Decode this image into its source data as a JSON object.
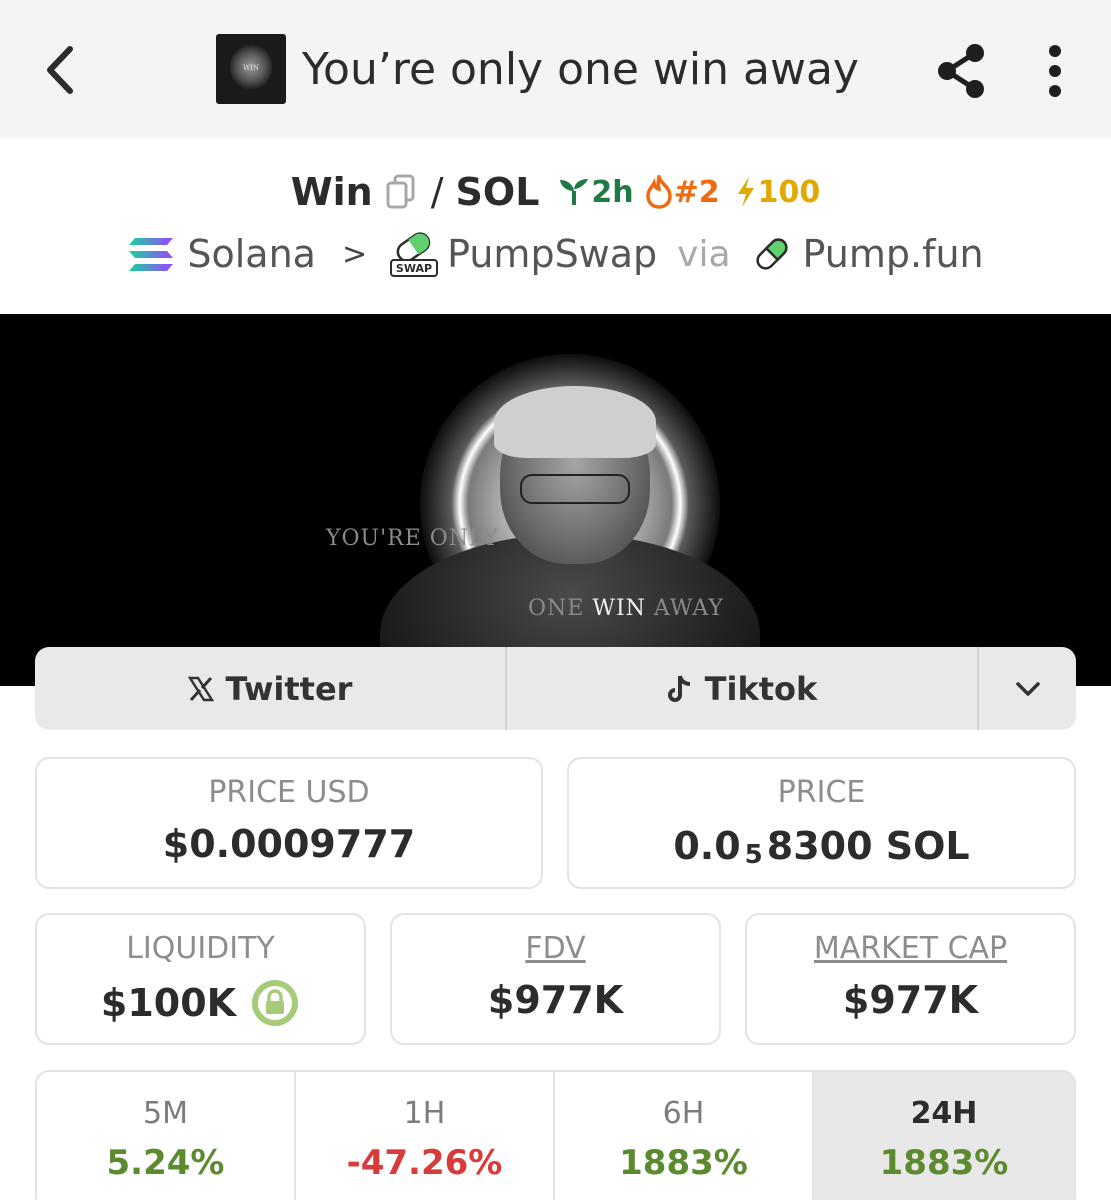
{
  "header": {
    "title": "You’re only one win away",
    "thumb_text": "WIN"
  },
  "pair": {
    "base": "Win",
    "separator": "/",
    "quote": "SOL",
    "age": "2h",
    "rank": "#2",
    "boosts": "100"
  },
  "chain": {
    "network": "Solana",
    "dex": "PumpSwap",
    "via": "via",
    "launchpad": "Pump.fun",
    "swap_badge": "SWAP"
  },
  "banner": {
    "line1": "YOU'RE ONLY",
    "line2_a": "ONE",
    "line2_b": "WIN",
    "line2_c": "AWAY"
  },
  "links": {
    "twitter": "Twitter",
    "tiktok": "Tiktok"
  },
  "stats": {
    "price_usd_label": "PRICE USD",
    "price_usd": "$0.0009777",
    "price_label": "PRICE",
    "price_main": "0.0",
    "price_sub": "5",
    "price_rest": "8300 SOL",
    "liquidity_label": "LIQUIDITY",
    "liquidity": "$100K",
    "fdv_label": "FDV",
    "fdv": "$977K",
    "mcap_label": "MARKET CAP",
    "mcap": "$977K"
  },
  "performance": [
    {
      "label": "5M",
      "value": "5.24%"
    },
    {
      "label": "1H",
      "value": "-47.26%"
    },
    {
      "label": "6H",
      "value": "1883%"
    },
    {
      "label": "24H",
      "value": "1883%"
    }
  ],
  "colors": {
    "positive": "#5c8a2e",
    "negative": "#d93a3a",
    "age": "#1f7a45",
    "rank": "#f06a12",
    "boost": "#e0a800"
  }
}
